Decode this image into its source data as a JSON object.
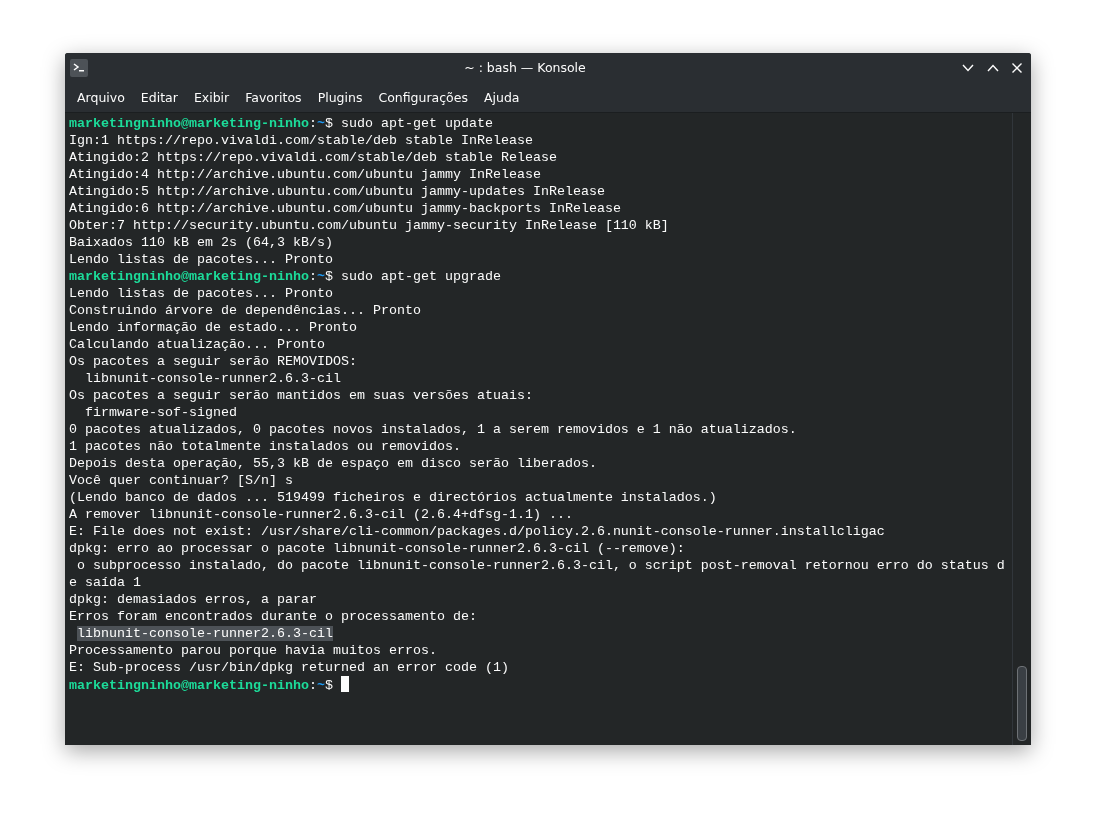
{
  "window": {
    "title": "~ : bash — Konsole"
  },
  "menu": [
    "Arquivo",
    "Editar",
    "Exibir",
    "Favoritos",
    "Plugins",
    "Configurações",
    "Ajuda"
  ],
  "terminal": {
    "lines": [
      {
        "kind": "prompt",
        "user": "marketingninho@marketing-ninho",
        "separator": ":",
        "path": "~",
        "symbol": "$",
        "command": "sudo apt-get update",
        "cursor": false
      },
      {
        "kind": "output",
        "text": "Ign:1 https://repo.vivaldi.com/stable/deb stable InRelease",
        "selected": false
      },
      {
        "kind": "output",
        "text": "Atingido:2 https://repo.vivaldi.com/stable/deb stable Release",
        "selected": false
      },
      {
        "kind": "output",
        "text": "Atingido:4 http://archive.ubuntu.com/ubuntu jammy InRelease",
        "selected": false
      },
      {
        "kind": "output",
        "text": "Atingido:5 http://archive.ubuntu.com/ubuntu jammy-updates InRelease",
        "selected": false
      },
      {
        "kind": "output",
        "text": "Atingido:6 http://archive.ubuntu.com/ubuntu jammy-backports InRelease",
        "selected": false
      },
      {
        "kind": "output",
        "text": "Obter:7 http://security.ubuntu.com/ubuntu jammy-security InRelease [110 kB]",
        "selected": false
      },
      {
        "kind": "output",
        "text": "Baixados 110 kB em 2s (64,3 kB/s)",
        "selected": false
      },
      {
        "kind": "output",
        "text": "Lendo listas de pacotes... Pronto",
        "selected": false
      },
      {
        "kind": "prompt",
        "user": "marketingninho@marketing-ninho",
        "separator": ":",
        "path": "~",
        "symbol": "$",
        "command": "sudo apt-get upgrade",
        "cursor": false
      },
      {
        "kind": "output",
        "text": "Lendo listas de pacotes... Pronto",
        "selected": false
      },
      {
        "kind": "output",
        "text": "Construindo árvore de dependências... Pronto",
        "selected": false
      },
      {
        "kind": "output",
        "text": "Lendo informação de estado... Pronto",
        "selected": false
      },
      {
        "kind": "output",
        "text": "Calculando atualização... Pronto",
        "selected": false
      },
      {
        "kind": "output",
        "text": "Os pacotes a seguir serão REMOVIDOS:",
        "selected": false
      },
      {
        "kind": "output",
        "text": "  libnunit-console-runner2.6.3-cil",
        "selected": false
      },
      {
        "kind": "output",
        "text": "Os pacotes a seguir serão mantidos em suas versões atuais:",
        "selected": false
      },
      {
        "kind": "output",
        "text": "  firmware-sof-signed",
        "selected": false
      },
      {
        "kind": "output",
        "text": "0 pacotes atualizados, 0 pacotes novos instalados, 1 a serem removidos e 1 não atualizados.",
        "selected": false
      },
      {
        "kind": "output",
        "text": "1 pacotes não totalmente instalados ou removidos.",
        "selected": false
      },
      {
        "kind": "output",
        "text": "Depois desta operação, 55,3 kB de espaço em disco serão liberados.",
        "selected": false
      },
      {
        "kind": "output",
        "text": "Você quer continuar? [S/n] s",
        "selected": false
      },
      {
        "kind": "output",
        "text": "(Lendo banco de dados ... 519499 ficheiros e directórios actualmente instalados.)",
        "selected": false
      },
      {
        "kind": "output",
        "text": "A remover libnunit-console-runner2.6.3-cil (2.6.4+dfsg-1.1) ...",
        "selected": false
      },
      {
        "kind": "output",
        "text": "E: File does not exist: /usr/share/cli-common/packages.d/policy.2.6.nunit-console-runner.installcligac",
        "selected": false
      },
      {
        "kind": "output",
        "text": "dpkg: erro ao processar o pacote libnunit-console-runner2.6.3-cil (--remove):",
        "selected": false
      },
      {
        "kind": "output",
        "text": " o subprocesso instalado, do pacote libnunit-console-runner2.6.3-cil, o script post-removal retornou erro do status d",
        "selected": false
      },
      {
        "kind": "output",
        "text": "e saída 1",
        "selected": false
      },
      {
        "kind": "output",
        "text": "dpkg: demasiados erros, a parar",
        "selected": false
      },
      {
        "kind": "output",
        "text": "Erros foram encontrados durante o processamento de:",
        "selected": false
      },
      {
        "kind": "output",
        "text": "libnunit-console-runner2.6.3-cil",
        "selected": true
      },
      {
        "kind": "output",
        "text": "Processamento parou porque havia muitos erros.",
        "selected": false
      },
      {
        "kind": "output",
        "text": "E: Sub-process /usr/bin/dpkg returned an error code (1)",
        "selected": false
      },
      {
        "kind": "prompt",
        "user": "marketingninho@marketing-ninho",
        "separator": ":",
        "path": "~",
        "symbol": "$",
        "cursor": true
      }
    ]
  }
}
